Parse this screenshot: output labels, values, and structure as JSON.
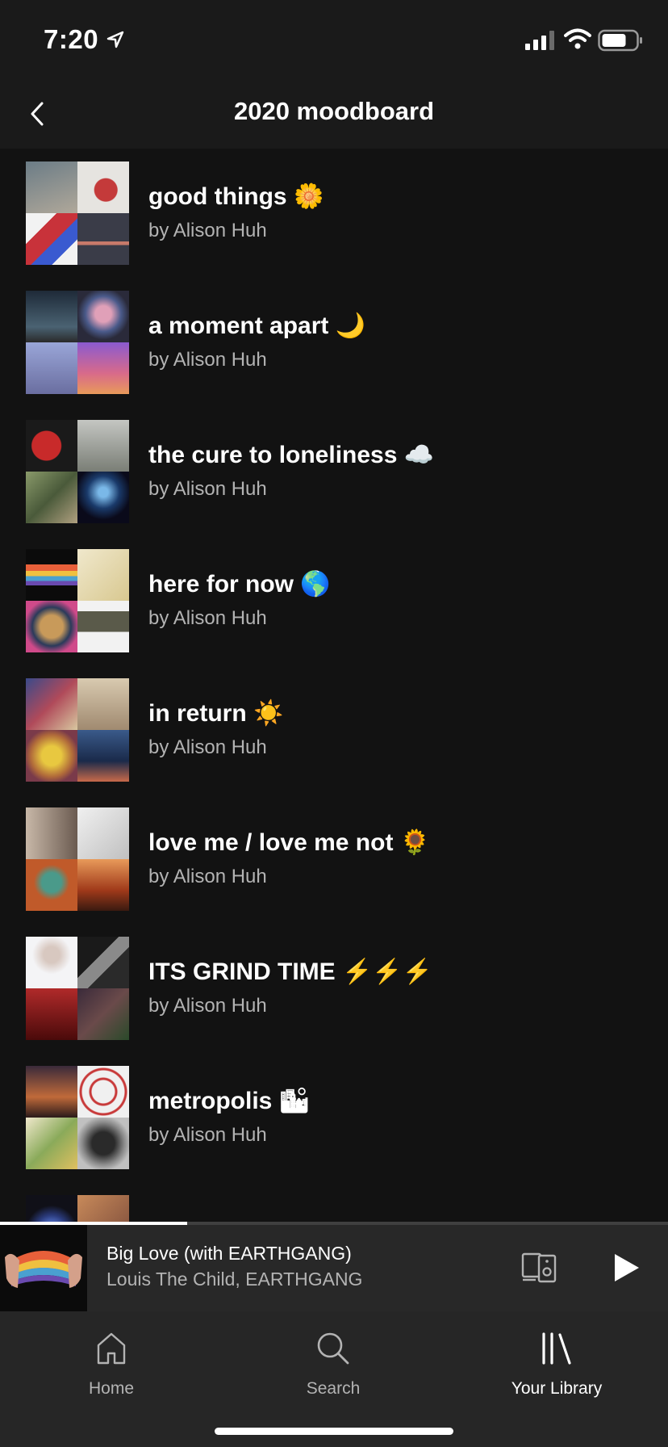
{
  "status_bar": {
    "time": "7:20"
  },
  "header": {
    "title": "2020 moodboard",
    "back_icon": "chevron-left-icon"
  },
  "playlists": [
    {
      "title": "good things 🌼",
      "subtitle": "by Alison Huh",
      "art_colors": [
        "#8a8c84",
        "#d8d6d2",
        "#c43a3a",
        "#4a4a52"
      ]
    },
    {
      "title": "a moment apart 🌙",
      "subtitle": "by Alison Huh",
      "art_colors": [
        "#2b3a48",
        "#6c4b6e",
        "#7a7ea8",
        "#b44a7a"
      ]
    },
    {
      "title": "the cure to loneliness ☁️",
      "subtitle": "by Alison Huh",
      "art_colors": [
        "#b02a2a",
        "#9ea2a0",
        "#6a7454",
        "#1a3a5c"
      ]
    },
    {
      "title": "here for now 🌎",
      "subtitle": "by Alison Huh",
      "art_colors": [
        "#1a1a1a",
        "#e9e0c6",
        "#2a4a8a",
        "#e6e6e6"
      ]
    },
    {
      "title": "in return ☀️",
      "subtitle": "by Alison Huh",
      "art_colors": [
        "#5a4e7a",
        "#c8b89a",
        "#b87a3a",
        "#2c4466"
      ]
    },
    {
      "title": "love me / love me not 🌻",
      "subtitle": "by Alison Huh",
      "art_colors": [
        "#8c7a6c",
        "#d8d8d8",
        "#b0582a",
        "#c4502a"
      ]
    },
    {
      "title": "ITS GRIND TIME ⚡️⚡️⚡️",
      "subtitle": "by Alison Huh",
      "art_colors": [
        "#e8e8ea",
        "#3a3a3a",
        "#8a1a1a",
        "#4a3a42"
      ]
    },
    {
      "title": "metropolis 🏙",
      "subtitle": "by Alison Huh",
      "art_colors": [
        "#5a3a2a",
        "#e6e6e6",
        "#7a9a5a",
        "#5a5a5a"
      ]
    },
    {
      "title": "",
      "subtitle": "",
      "art_colors": [
        "#2a3a7a",
        "#c88a5a",
        "#1a1a2a",
        "#3a2a1a"
      ]
    }
  ],
  "now_playing": {
    "title": "Big Love (with EARTHGANG)",
    "artist": "Louis The Child, EARTHGANG",
    "progress": 0.28
  },
  "tabs": [
    {
      "label": "Home",
      "icon": "home-icon",
      "active": false
    },
    {
      "label": "Search",
      "icon": "search-icon",
      "active": false
    },
    {
      "label": "Your Library",
      "icon": "library-icon",
      "active": true
    }
  ],
  "colors": {
    "background": "#121212",
    "bar": "#1a1a1a",
    "player": "#282828",
    "tabbar": "#262626",
    "secondary_text": "#b3b3b3"
  }
}
